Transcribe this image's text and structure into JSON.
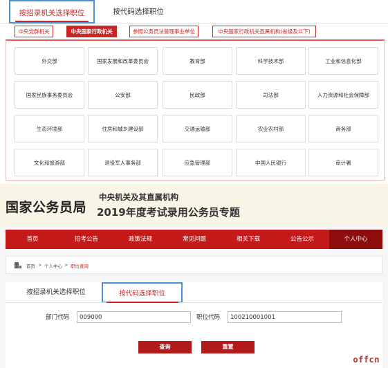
{
  "top_panel": {
    "tabs": [
      {
        "label": "按招录机关选择职位",
        "active": true
      },
      {
        "label": "按代码选择职位",
        "active": false
      }
    ],
    "sub_tabs": [
      {
        "label": "中央党群机关",
        "active": false
      },
      {
        "label": "中央国家行政机关",
        "active": true
      },
      {
        "label": "参照公务员法管理事业单位",
        "active": false
      },
      {
        "label": "中央国家行政机关直属机构(省级及以下)",
        "active": false
      }
    ],
    "departments": [
      "外交部",
      "国家发展和改革委员会",
      "教育部",
      "科学技术部",
      "工业和信息化部",
      "国家民族事务委员会",
      "公安部",
      "民政部",
      "司法部",
      "人力资源和社会保障部",
      "生态环境部",
      "住房和城乡建设部",
      "交通运输部",
      "农业农村部",
      "商务部",
      "文化和旅游部",
      "退役军人事务部",
      "应急管理部",
      "中国人民银行",
      "审计署"
    ]
  },
  "banner": {
    "title": "国家公务员局",
    "line1": "中央机关及其直属机构",
    "line2": "2019年度考试录用公务员专题"
  },
  "nav": {
    "items": [
      {
        "label": "首页",
        "active": false
      },
      {
        "label": "招考公告",
        "active": false
      },
      {
        "label": "政策法规",
        "active": false
      },
      {
        "label": "常见问题",
        "active": false
      },
      {
        "label": "相关下载",
        "active": false
      },
      {
        "label": "公告公示",
        "active": false
      },
      {
        "label": "个人中心",
        "active": true
      }
    ]
  },
  "breadcrumb": {
    "items": [
      "首页",
      "个人中心",
      "职位查询"
    ],
    "separator": ">"
  },
  "content": {
    "tabs": [
      {
        "label": "按招录机关选择职位",
        "active": false
      },
      {
        "label": "按代码选择职位",
        "active": true
      }
    ],
    "fields": {
      "dept_code_label": "部门代码",
      "dept_code_value": "009000",
      "pos_code_label": "职位代码",
      "pos_code_value": "100210001001"
    },
    "buttons": {
      "query": "查询",
      "reset": "重置"
    }
  },
  "watermark": "offcn",
  "colors": {
    "accent_red": "#c62828",
    "nav_red": "#c41a1a",
    "nav_active": "#8e0c0c",
    "highlight_blue": "#4a90d9",
    "banner_bg": "#f8f4e6"
  }
}
